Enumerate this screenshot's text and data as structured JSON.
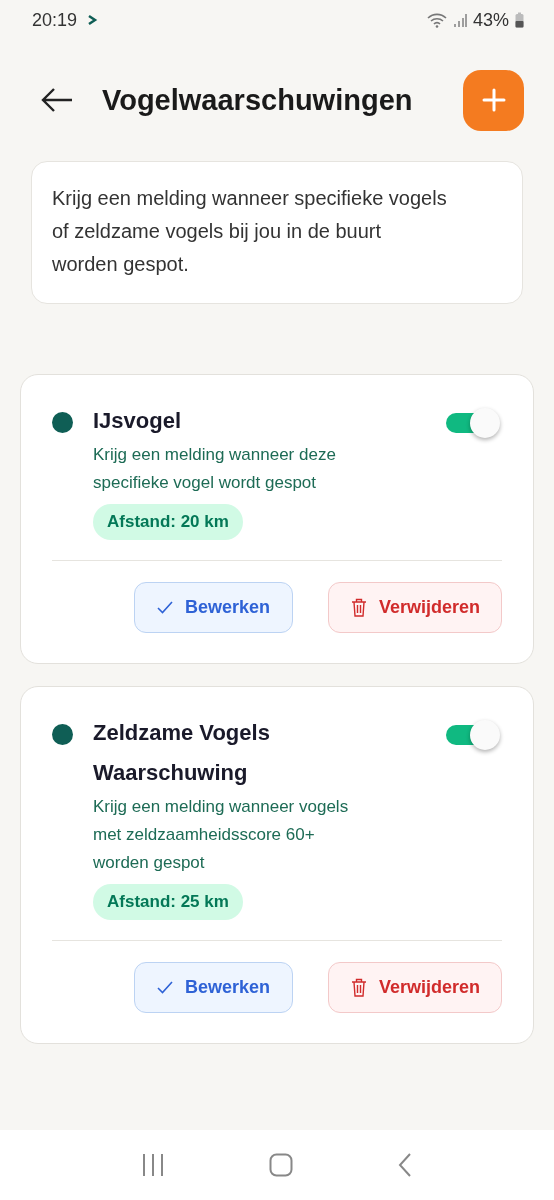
{
  "status_bar": {
    "time": "20:19",
    "battery": "43%"
  },
  "header": {
    "title": "Vogelwaarschuwingen"
  },
  "intro": "Krijg een melding wanneer specifieke vogels of zeldzame vogels bij jou in de buurt worden gespot.",
  "alerts": [
    {
      "title": "IJsvogel",
      "description": "Krijg een melding wanneer deze specifieke vogel wordt gespot",
      "distance": "Afstand: 20 km",
      "on": true,
      "edit_label": "Bewerken",
      "delete_label": "Verwijderen"
    },
    {
      "title": "Zeldzame Vogels Waarschuwing",
      "description": "Krijg een melding wanneer vogels met zeldzaamheidsscore 60+ worden gespot",
      "distance": "Afstand: 25 km",
      "on": true,
      "edit_label": "Bewerken",
      "delete_label": "Verwijderen"
    }
  ]
}
